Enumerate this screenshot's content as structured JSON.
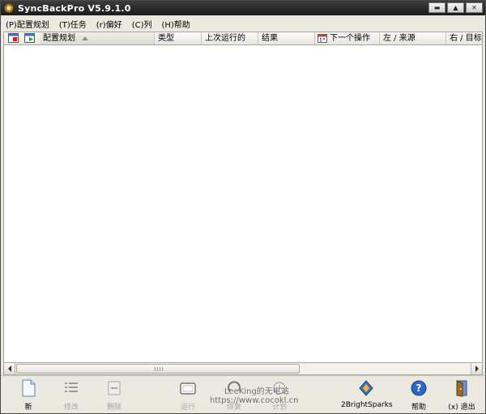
{
  "window": {
    "title": "SyncBackPro V5.9.1.0"
  },
  "menubar": {
    "items": [
      "(P)配置规划",
      "(T)任务",
      "(r)偏好",
      "(C)列",
      "(H)帮助"
    ]
  },
  "list_header": {
    "columns": [
      "配置规划",
      "类型",
      "上次运行的",
      "结果",
      "下一个操作",
      "左 / 来源",
      "右 / 目标"
    ]
  },
  "toolbar": {
    "new_label": "新",
    "modify_label": "修改",
    "delete_label": "删除",
    "run_label": "运行",
    "restore_label": "恢复",
    "schedule_label": "计划",
    "brand_label": "2BrightSparks",
    "help_label": "帮助",
    "exit_label": "(x) 退出"
  },
  "watermark": {
    "text": "LeeKing的无电站",
    "url": "https://www.cocokl.cn"
  },
  "colors": {
    "titlebar": "#2a2a2a",
    "list_bg": "#ffffff",
    "chrome": "#ece9e0",
    "help_blue": "#2b67c9"
  }
}
